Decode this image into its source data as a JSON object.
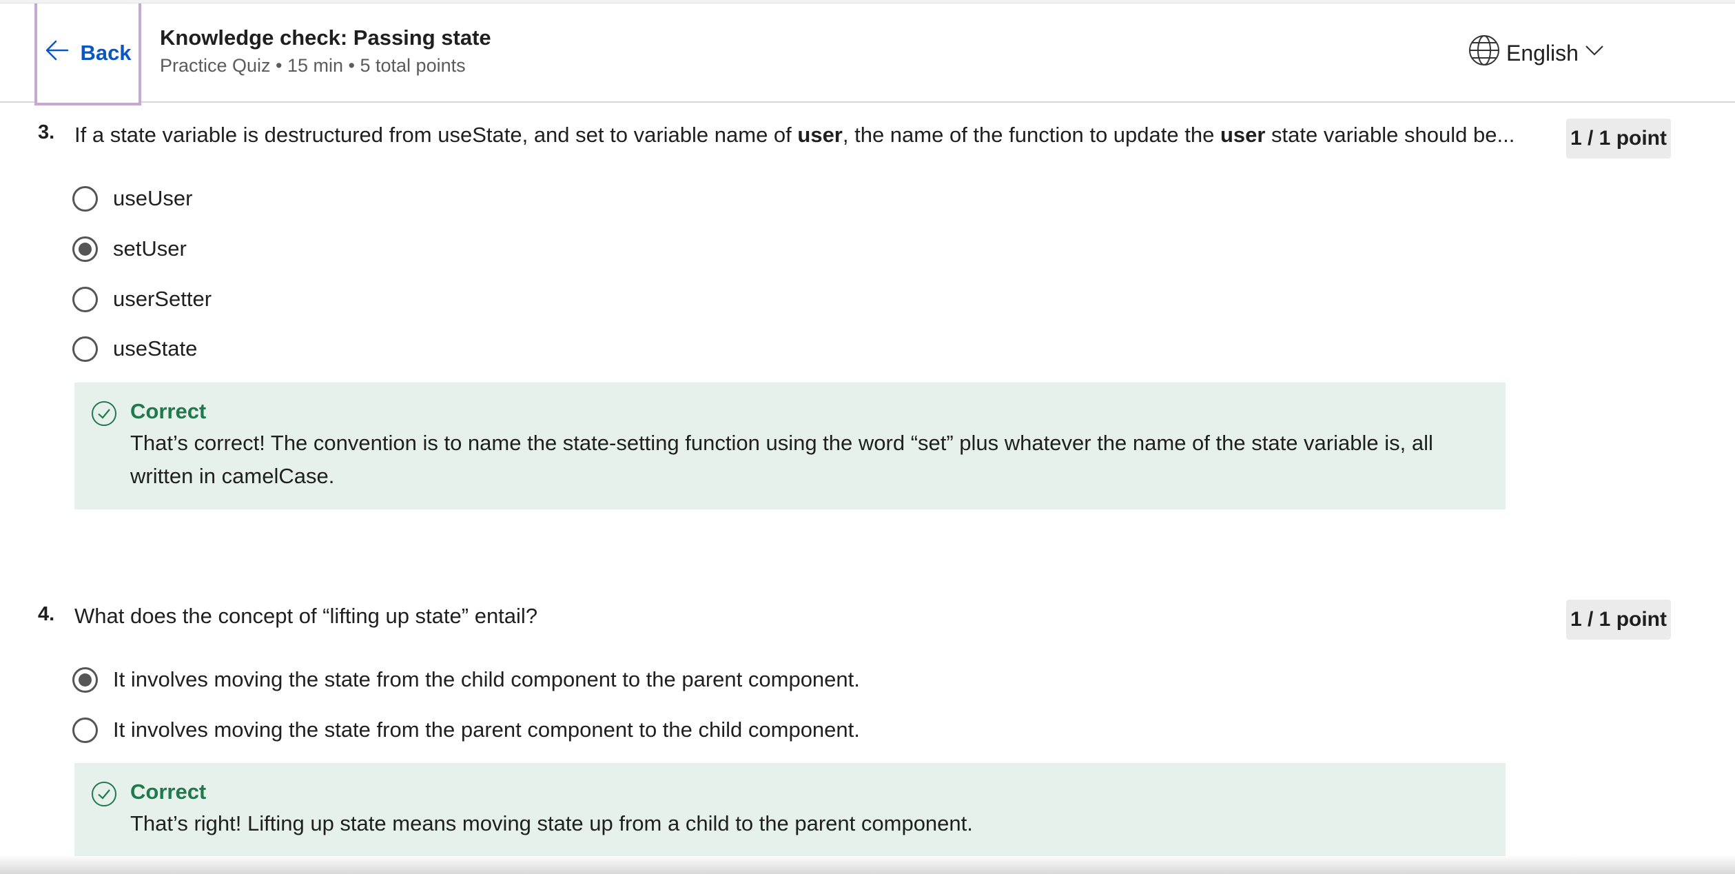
{
  "header": {
    "back_label": "Back",
    "title": "Knowledge check: Passing state",
    "meta": "Practice Quiz • 15 min • 5 total points",
    "language": "English"
  },
  "questions": [
    {
      "number": "3.",
      "text_parts": [
        "If a state variable is destructured from useState, and set to variable name of ",
        "user",
        ", the name of the function to update the ",
        "user",
        " state variable should be..."
      ],
      "points": "1 / 1 point",
      "options": [
        {
          "label": "useUser",
          "selected": false
        },
        {
          "label": "setUser",
          "selected": true
        },
        {
          "label": "userSetter",
          "selected": false
        },
        {
          "label": "useState",
          "selected": false
        }
      ],
      "feedback": {
        "title": "Correct",
        "text": "That’s correct! The convention is to name the state-setting function using the word “set” plus whatever the name of the state variable is, all written in camelCase."
      }
    },
    {
      "number": "4.",
      "text": "What does the concept of “lifting up state” entail?",
      "points": "1 / 1 point",
      "options": [
        {
          "label": "It involves moving the state from the child component to the parent component.",
          "selected": true
        },
        {
          "label": "It involves moving the state from the parent component to the child component.",
          "selected": false
        }
      ],
      "feedback": {
        "title": "Correct",
        "text": "That’s right! Lifting up state means moving state up from a child to the parent component."
      }
    }
  ],
  "colors": {
    "accent": "#0a56c2",
    "correct": "#20794a",
    "feedback_bg": "#e6f1ec",
    "back_focus": "#c5a8d6"
  },
  "icons": [
    "arrow-left-icon",
    "globe-icon",
    "chevron-down-icon",
    "check-circle-icon"
  ]
}
